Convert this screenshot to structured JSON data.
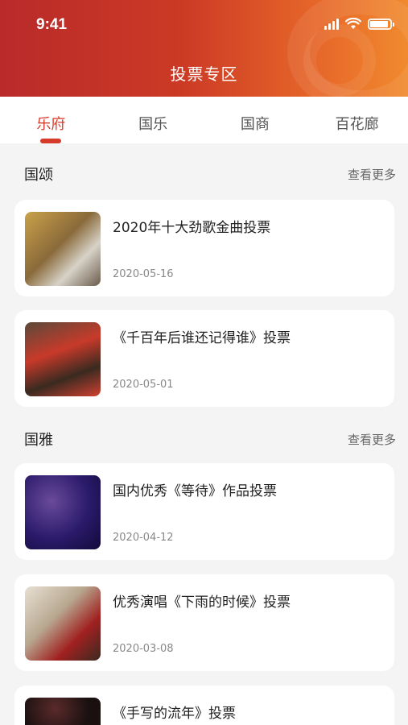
{
  "status_bar": {
    "time": "9:41"
  },
  "header": {
    "title": "投票专区"
  },
  "tabs": [
    {
      "label": "乐府",
      "active": true
    },
    {
      "label": "国乐",
      "active": false
    },
    {
      "label": "国商",
      "active": false
    },
    {
      "label": "百花廊",
      "active": false
    }
  ],
  "sections": [
    {
      "title": "国颂",
      "more_label": "查看更多",
      "items": [
        {
          "title": "2020年十大劲歌金曲投票",
          "date": "2020-05-16"
        },
        {
          "title": "《千百年后谁还记得谁》投票",
          "date": "2020-05-01"
        }
      ]
    },
    {
      "title": "国雅",
      "more_label": "查看更多",
      "items": [
        {
          "title": "国内优秀《等待》作品投票",
          "date": "2020-04-12"
        },
        {
          "title": "优秀演唱《下雨的时候》投票",
          "date": "2020-03-08"
        },
        {
          "title": "《手写的流年》投票",
          "date": ""
        }
      ]
    }
  ],
  "colors": {
    "accent": "#d63a2a",
    "header_start": "#b92a2a",
    "header_end": "#f08a2e"
  }
}
